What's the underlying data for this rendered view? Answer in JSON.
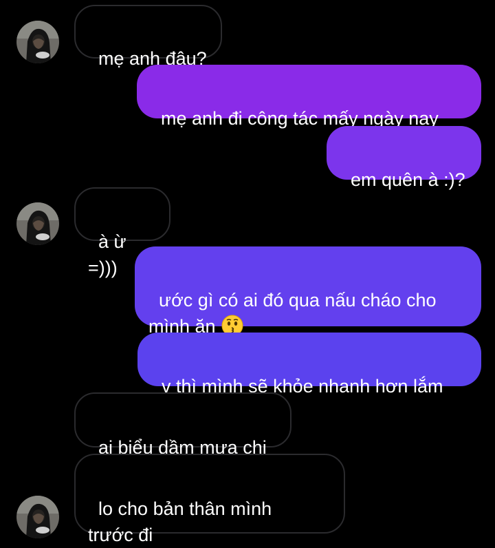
{
  "colors": {
    "background": "#000000",
    "incoming_border": "#2b2b2e",
    "outgoing_top": "#8a2be8",
    "outgoing_bottom": "#5b42ee"
  },
  "avatar_icon": "hooded-person-avatar-icon",
  "messages": [
    {
      "sender": "them",
      "text": "mẹ anh đâu?"
    },
    {
      "sender": "me",
      "text": "mẹ anh đi công tác mấy ngày nay"
    },
    {
      "sender": "me",
      "text": "em quên à :)?"
    },
    {
      "sender": "them",
      "text": "à ừ =)))"
    },
    {
      "sender": "me",
      "text": "ước gì có ai đó qua nấu cháo cho\nmình ăn",
      "emoji": "kissing-face-emoji"
    },
    {
      "sender": "me",
      "text": "v thì mình sẽ khỏe nhanh hơn lắm"
    },
    {
      "sender": "them",
      "text": "ai biểu dầm mưa chi"
    },
    {
      "sender": "them",
      "text": "lo cho bản thân mình\ntrước đi"
    }
  ]
}
